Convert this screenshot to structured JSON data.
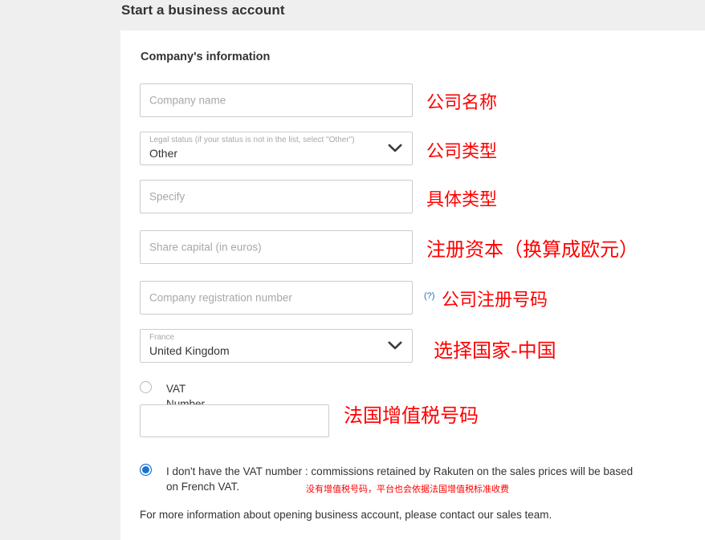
{
  "page": {
    "title": "Start a business account",
    "background": "#efefef",
    "card_background": "#ffffff"
  },
  "form": {
    "section_title": "Company's information",
    "fields": [
      {
        "name": "company-name",
        "type": "text",
        "placeholder": "Company name",
        "value": ""
      },
      {
        "name": "legal-status",
        "type": "select",
        "label": "Legal status (if your status is not in the list, select \"Other\")",
        "value": "Other"
      },
      {
        "name": "specify",
        "type": "text",
        "placeholder": "Specify",
        "value": ""
      },
      {
        "name": "share-capital",
        "type": "text",
        "placeholder": "Share capital (in euros)",
        "value": ""
      },
      {
        "name": "company-registration-number",
        "type": "text",
        "placeholder": "Company registration number",
        "value": ""
      },
      {
        "name": "country",
        "type": "select",
        "label": "France",
        "value": "United Kingdom"
      }
    ],
    "vat": {
      "radio_vat_label": "VAT Number",
      "radio_vat_selected": false,
      "vat_input_value": "",
      "radio_no_vat_label": "I don't have the VAT number : commissions retained by Rakuten on the sales prices will be based on French VAT.",
      "radio_no_vat_selected": true
    },
    "footer_note": "For more information about opening business account, please contact our sales team."
  },
  "help": {
    "registration_help": "(?)",
    "help_color": "#2a6ebb"
  },
  "annotations": {
    "color": "#ff0000",
    "items": [
      {
        "name": "company-name",
        "text": "公司名称"
      },
      {
        "name": "legal-status",
        "text": "公司类型"
      },
      {
        "name": "specify",
        "text": "具体类型"
      },
      {
        "name": "share-capital",
        "text": "注册资本（换算成欧元）"
      },
      {
        "name": "registration-number",
        "text": "公司注册号码"
      },
      {
        "name": "country",
        "text": "选择国家-中国"
      },
      {
        "name": "vat-number",
        "text": "法国增值税号码"
      },
      {
        "name": "no-vat-note",
        "text": "没有增值税号码，平台也会依据法国增值税标准收费"
      }
    ]
  }
}
